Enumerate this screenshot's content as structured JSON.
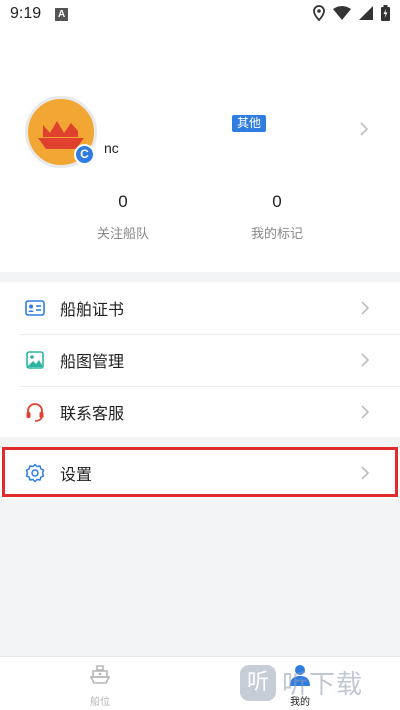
{
  "status_bar": {
    "time": "9:19",
    "notification_letter": "A"
  },
  "profile": {
    "avatar_badge": "C",
    "type_tag": "其他",
    "username": "nc",
    "stats": [
      {
        "value": "0",
        "label": "关注船队"
      },
      {
        "value": "0",
        "label": "我的标记"
      }
    ]
  },
  "menu": {
    "items": [
      {
        "label": "船舶证书",
        "icon": "certificate-icon"
      },
      {
        "label": "船图管理",
        "icon": "image-icon"
      },
      {
        "label": "联系客服",
        "icon": "headset-icon"
      }
    ],
    "settings": {
      "label": "设置",
      "icon": "gear-icon"
    }
  },
  "colors": {
    "accent": "#2f7de1",
    "avatar_bg": "#f2a735",
    "ship_red": "#e0402e",
    "highlight": "#e22a2a"
  },
  "tabbar": {
    "tabs": [
      {
        "label": "船位",
        "icon": "ship-icon",
        "active": false
      },
      {
        "label": "我的",
        "icon": "person-icon",
        "active": true
      }
    ]
  },
  "watermark": {
    "logo": "听",
    "text": "听下载"
  }
}
